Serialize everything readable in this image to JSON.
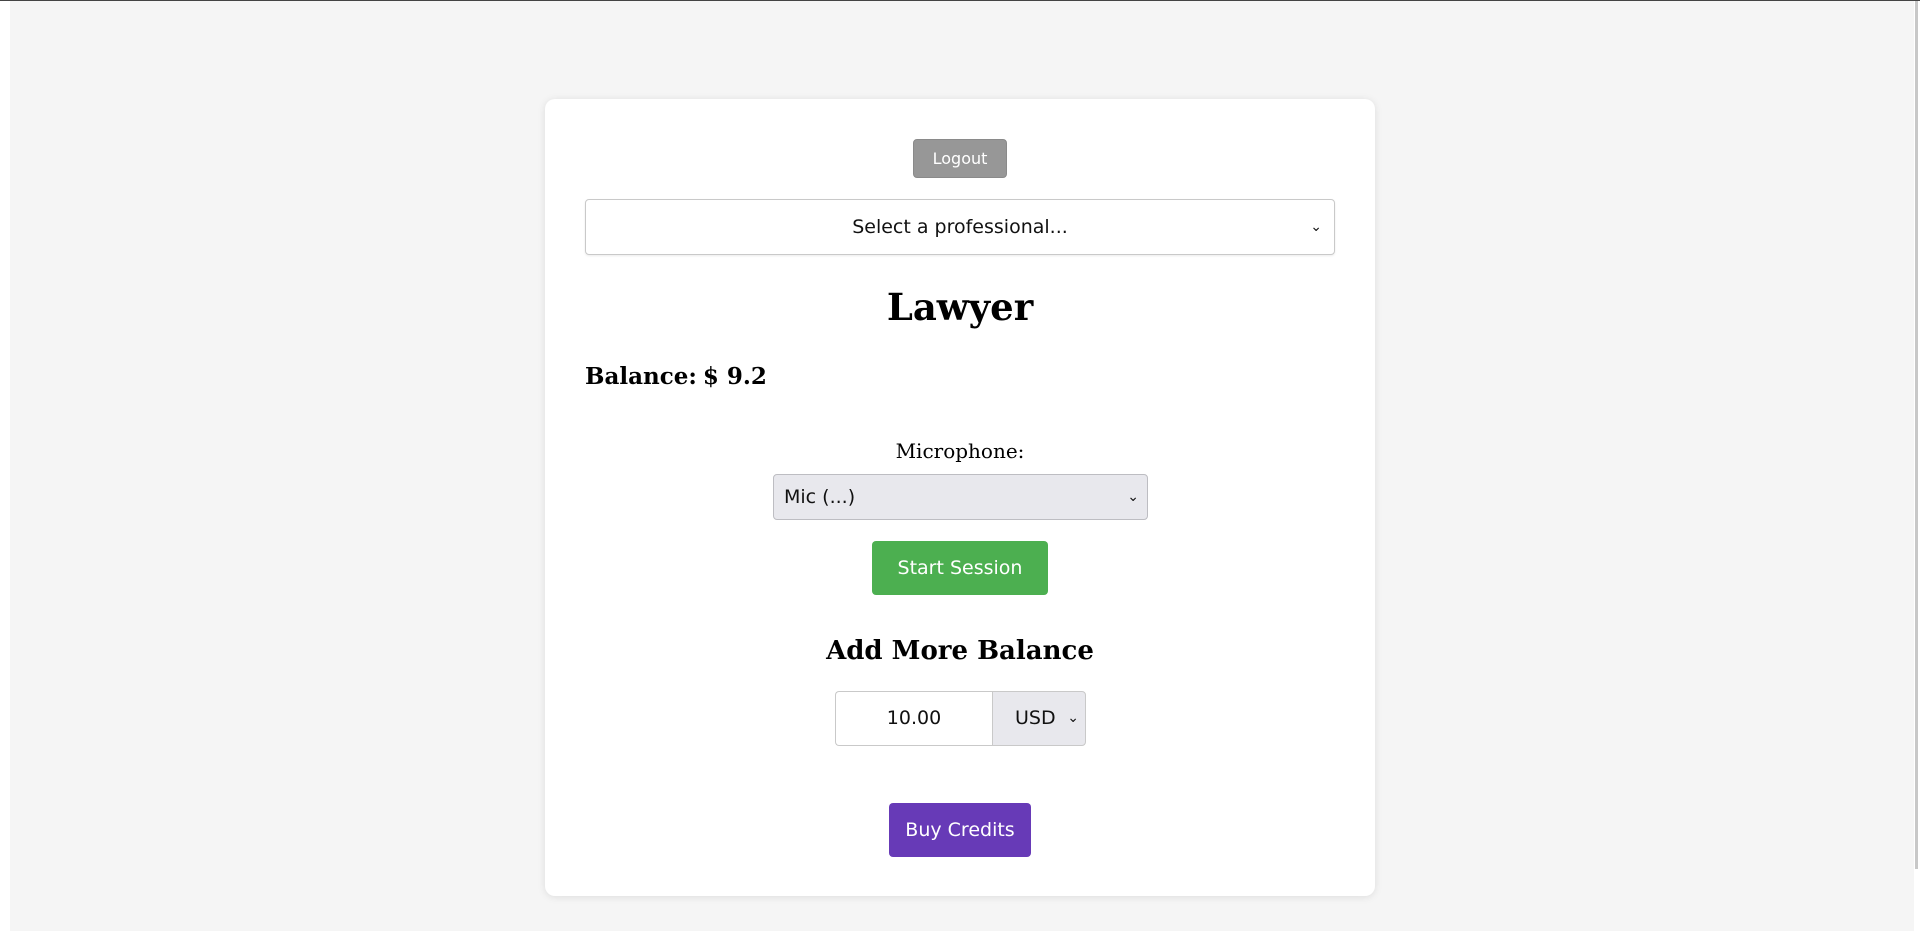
{
  "header": {
    "logout_label": "Logout"
  },
  "professional_select": {
    "selected": "Select a professional..."
  },
  "profile": {
    "title": "Lawyer",
    "balance_label": "Balance:",
    "balance_value": "$ 9.2"
  },
  "microphone": {
    "label": "Microphone:",
    "selected": "Mic (...)"
  },
  "session": {
    "start_label": "Start Session"
  },
  "topup": {
    "heading": "Add More Balance",
    "amount": "10.00",
    "currency": "USD",
    "buy_label": "Buy Credits"
  },
  "icons": {
    "dropdown": "chevron-down-icon"
  },
  "colors": {
    "start_button": "#4caf50",
    "buy_button": "#673ab7",
    "logout_button": "#979797",
    "page_background": "#f5f5f5"
  }
}
